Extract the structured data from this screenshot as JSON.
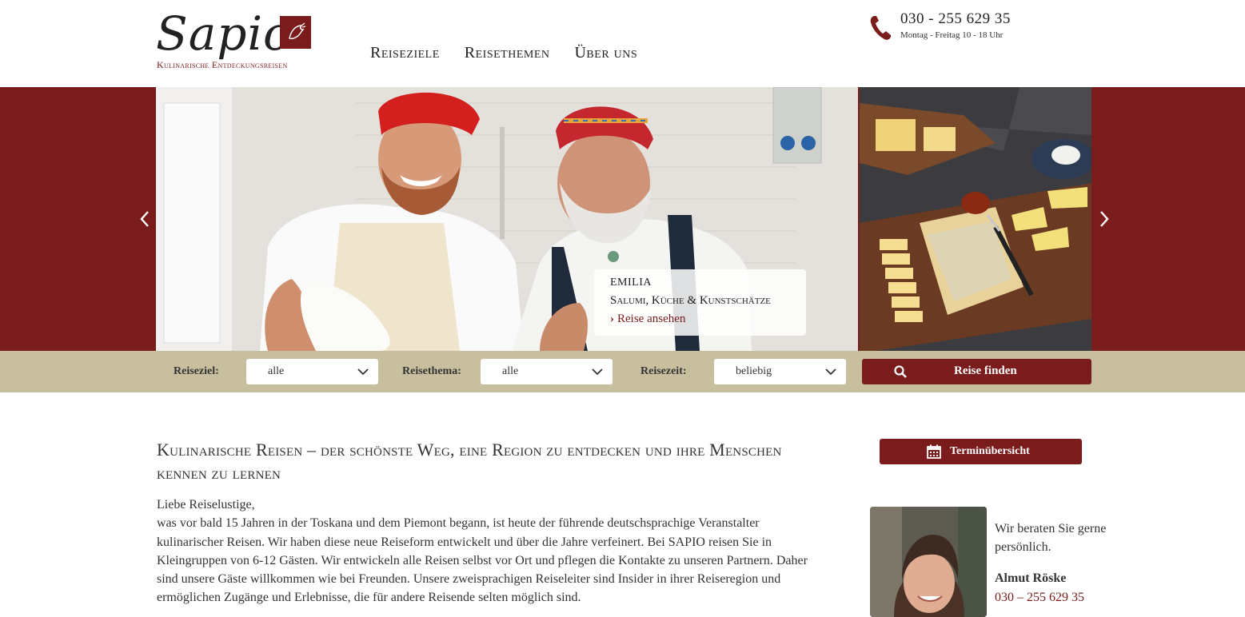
{
  "header": {
    "logo_text": "Sapio",
    "logo_subtitle": "Kulinarische Entdeckungsreisen",
    "nav": [
      {
        "label": "Reiseziele"
      },
      {
        "label": "Reisethemen"
      },
      {
        "label": "Über uns"
      }
    ],
    "phone_number": "030  -  255 629 35",
    "phone_hours": "Montag - Freitag 10 - 18 Uhr",
    "phone_icon": "phone-icon"
  },
  "hero": {
    "caption": {
      "title": "EMILIA",
      "subtitle": "Salumi, Küche & Kunstschätze",
      "link": "Reise ansehen"
    },
    "prev_icon": "chevron-left-icon",
    "next_icon": "chevron-right-icon"
  },
  "search": {
    "destination_label": "Reiseziel:",
    "destination_value": "alle",
    "theme_label": "Reisethema:",
    "theme_value": "alle",
    "time_label": "Reisezeit:",
    "time_value": "beliebig",
    "button_label": "Reise finden"
  },
  "main": {
    "headline": "Kulinarische Reisen – der schönste Weg, eine Region zu entdecken und ihre Menschen kennen zu lernen",
    "greeting": "Liebe Reiselustige,",
    "body": "was vor bald 15 Jahren in der Toskana und dem Piemont begann, ist heute der führende deutschsprachige Veranstalter kulinarischer Reisen. Wir haben diese neue Reiseform entwickelt und über die Jahre verfeinert. Bei SAPIO reisen Sie in Kleingruppen von 6-12 Gästen. Wir entwickeln alle Reisen selbst vor Ort und pflegen die Kontakte zu unseren Partnern. Daher sind unsere Gäste willkommen wie bei Freunden. Unsere zweisprachigen Reiseleiter sind Insider in ihrer Reiseregion und ermöglichen Zugänge und Erlebnisse, die für andere Reisende selten möglich sind."
  },
  "sidebar": {
    "termin_label": "Terminübersicht",
    "advisor_text": "Wir beraten Sie gerne persönlich.",
    "advisor_name": "Almut Röske",
    "advisor_phone": "030 – 255 629 35"
  },
  "colors": {
    "brand": "#7a1c1c",
    "search_bar": "#c8bf9e"
  }
}
